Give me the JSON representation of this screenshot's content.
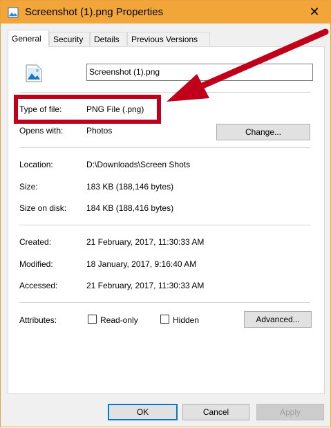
{
  "window": {
    "title": "Screenshot (1).png Properties",
    "close_glyph": "✕"
  },
  "tabs": [
    {
      "label": "General",
      "active": true
    },
    {
      "label": "Security",
      "active": false
    },
    {
      "label": "Details",
      "active": false
    },
    {
      "label": "Previous Versions",
      "active": false
    }
  ],
  "general": {
    "filename": "Screenshot (1).png",
    "type_label": "Type of file:",
    "type_value": "PNG File (.png)",
    "opens_label": "Opens with:",
    "opens_value": "Photos",
    "change_button": "Change...",
    "location_label": "Location:",
    "location_value": "D:\\Downloads\\Screen Shots",
    "size_label": "Size:",
    "size_value": "183 KB (188,146 bytes)",
    "size_disk_label": "Size on disk:",
    "size_disk_value": "184 KB (188,416 bytes)",
    "created_label": "Created:",
    "created_value": "21 February, 2017, 11:30:33 AM",
    "modified_label": "Modified:",
    "modified_value": "18 January, 2017, 9:16:40 AM",
    "accessed_label": "Accessed:",
    "accessed_value": "21 February, 2017, 11:30:33 AM",
    "attributes_label": "Attributes:",
    "readonly_label": "Read-only",
    "readonly_checked": false,
    "hidden_label": "Hidden",
    "hidden_checked": false,
    "advanced_button": "Advanced..."
  },
  "footer": {
    "ok_button": "OK",
    "cancel_button": "Cancel",
    "apply_button": "Apply"
  },
  "colors": {
    "titlebar": "#f2a63a",
    "annotation": "#c0001b",
    "focus_border": "#0078d7"
  }
}
